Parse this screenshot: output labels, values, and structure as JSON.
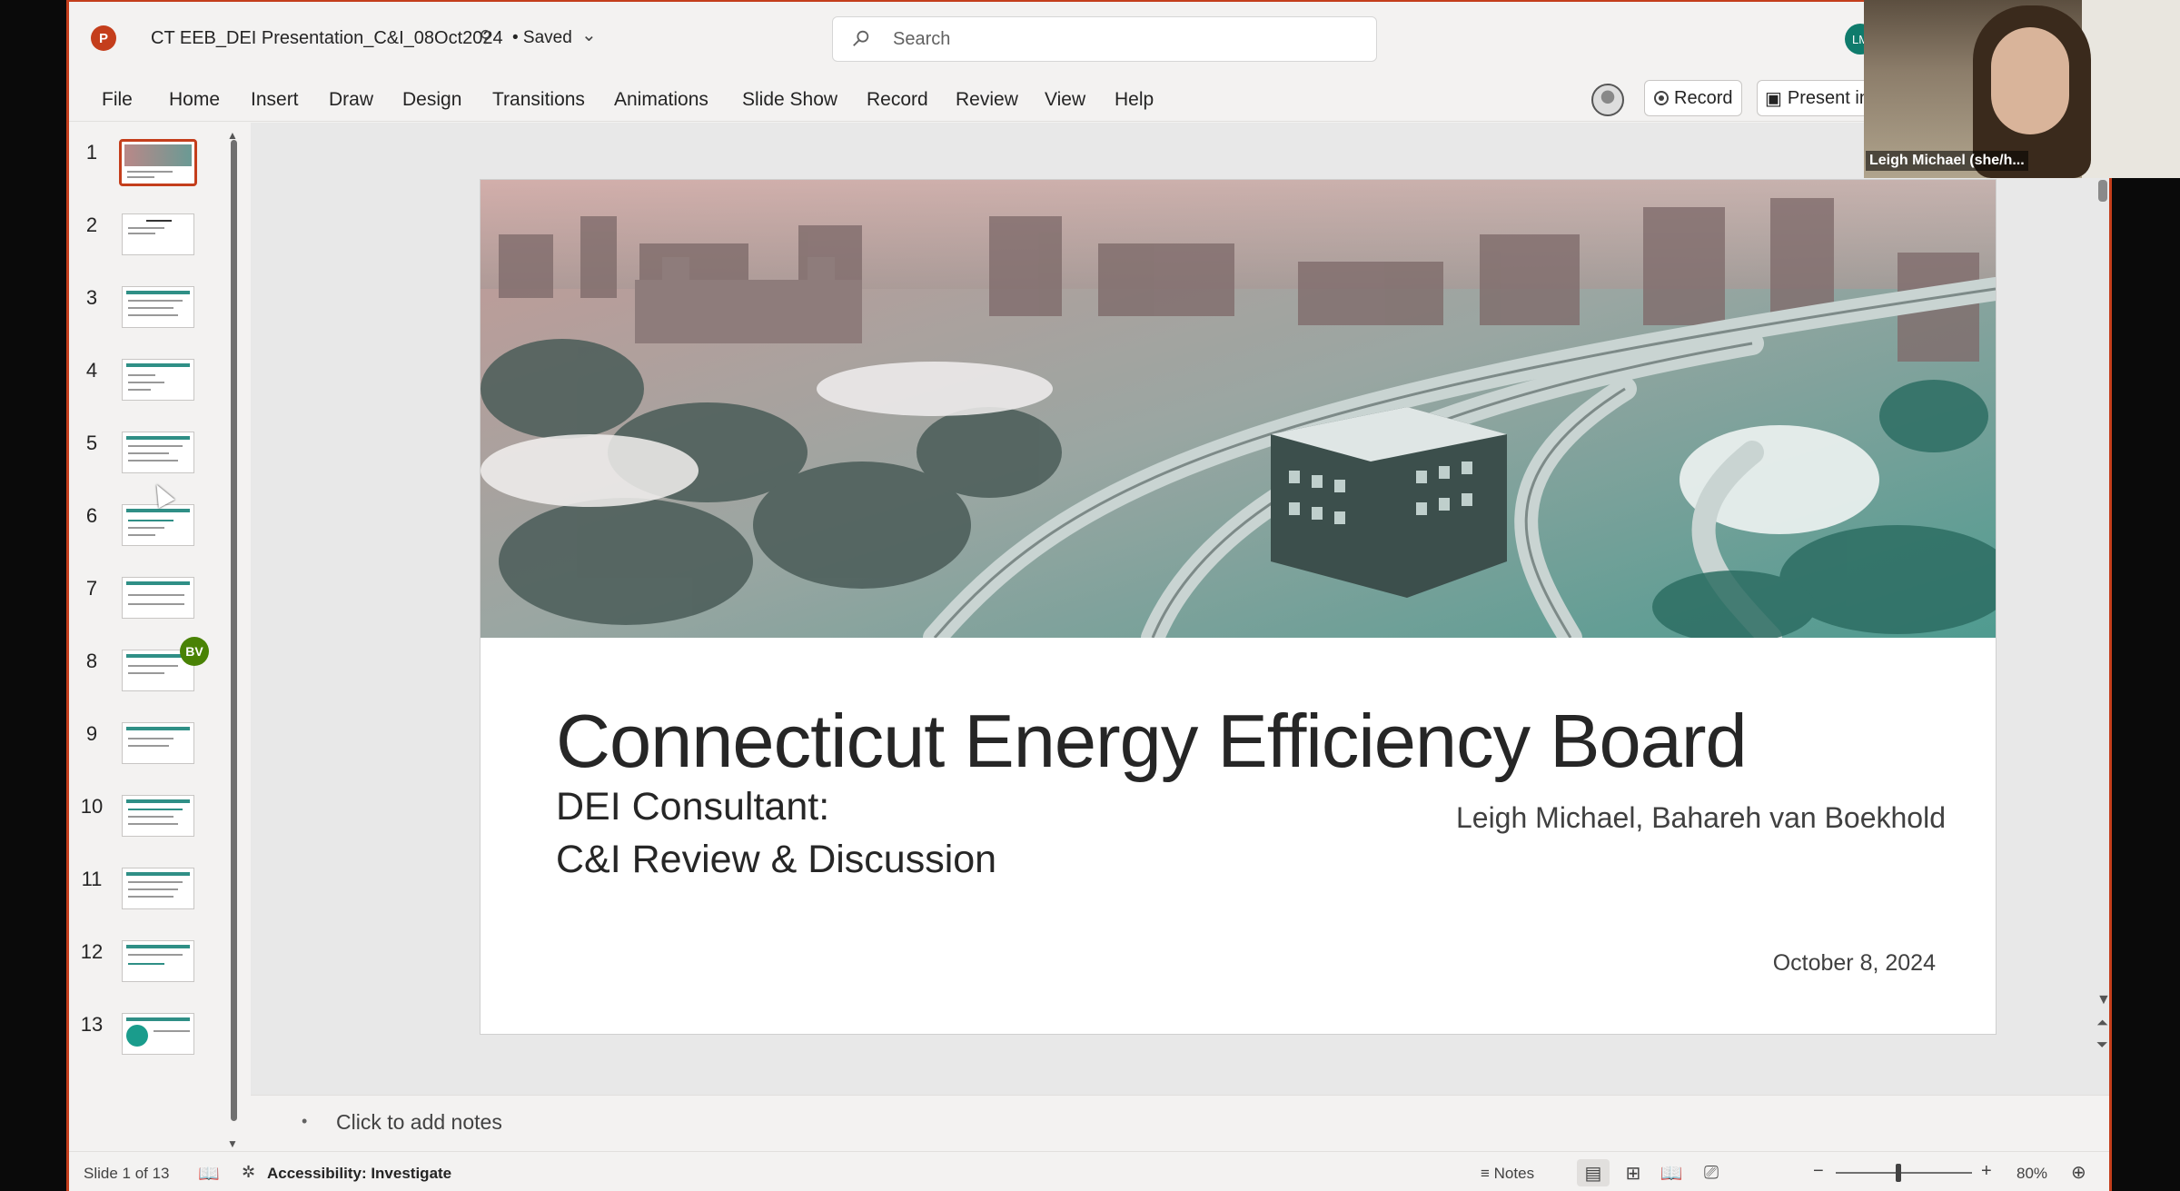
{
  "app": {
    "logo_letter": "P",
    "document_title": "CT EEB_DEI Presentation_C&I_08Oct2024",
    "save_status": "• Saved",
    "accent_color": "#c43e1c"
  },
  "search": {
    "placeholder": "Search"
  },
  "account": {
    "initials": "LM"
  },
  "menu": {
    "items": [
      "File",
      "Home",
      "Insert",
      "Draw",
      "Design",
      "Transitions",
      "Animations",
      "Slide Show",
      "Record",
      "Review",
      "View",
      "Help"
    ],
    "record_label": "Record",
    "present_label": "Present in Teams"
  },
  "webcam": {
    "name": "Leigh Michael (she/h..."
  },
  "thumbnails": {
    "numbers": [
      "1",
      "2",
      "3",
      "4",
      "5",
      "6",
      "7",
      "8",
      "9",
      "10",
      "11",
      "12",
      "13"
    ],
    "active_index": 1,
    "badge_initials": "BV"
  },
  "slide": {
    "title": "Connecticut Energy Efficiency Board",
    "subtitle_line1": "DEI Consultant:",
    "subtitle_line2": "C&I Review & Discussion",
    "authors": "Leigh Michael, Bahareh van Boekhold",
    "date": "October 8, 2024"
  },
  "notes": {
    "placeholder": "Click to add notes"
  },
  "status": {
    "slide_count": "Slide 1 of 13",
    "accessibility": "Accessibility: Investigate",
    "notes_label": "Notes",
    "zoom": "80%",
    "zoom_level_fraction": 0.46
  }
}
